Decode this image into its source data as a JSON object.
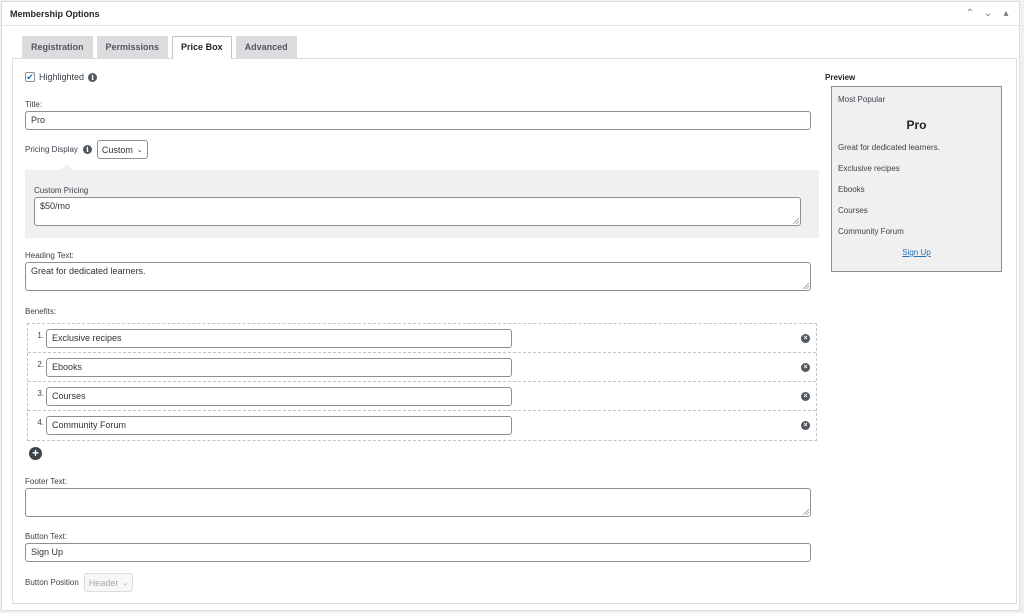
{
  "postbox": {
    "title": "Membership Options",
    "controls": {
      "up": "⌃",
      "down": "⌄",
      "toggle": "▴"
    }
  },
  "tabs": [
    {
      "label": "Registration",
      "active": false
    },
    {
      "label": "Permissions",
      "active": false
    },
    {
      "label": "Price Box",
      "active": true
    },
    {
      "label": "Advanced",
      "active": false
    }
  ],
  "form": {
    "highlighted": {
      "label": "Highlighted",
      "checked": true
    },
    "title": {
      "label": "Title:",
      "value": "Pro"
    },
    "pricing_display": {
      "label": "Pricing Display",
      "selected": "Custom"
    },
    "custom_pricing": {
      "label": "Custom Pricing",
      "value": "$50/mo"
    },
    "heading_text": {
      "label": "Heading Text:",
      "value": "Great for dedicated learners."
    },
    "benefits": {
      "label": "Benefits:",
      "items": [
        {
          "num": "1.",
          "value": "Exclusive recipes"
        },
        {
          "num": "2.",
          "value": "Ebooks"
        },
        {
          "num": "3.",
          "value": "Courses"
        },
        {
          "num": "4.",
          "value": "Community Forum"
        }
      ]
    },
    "footer_text": {
      "label": "Footer Text:",
      "value": ""
    },
    "button_text": {
      "label": "Button Text:",
      "value": "Sign Up"
    },
    "button_position": {
      "label": "Button Position",
      "selected": "Header",
      "disabled": true
    }
  },
  "preview": {
    "label": "Preview",
    "badge": "Most Popular",
    "title": "Pro",
    "heading": "Great for dedicated learners.",
    "benefits": [
      "Exclusive recipes",
      "Ebooks",
      "Courses",
      "Community Forum"
    ],
    "button": "Sign Up"
  },
  "colors": {
    "accent": "#2271b1",
    "tab_inactive": "#dcdcde",
    "preview_bg": "#f0f0f1"
  }
}
